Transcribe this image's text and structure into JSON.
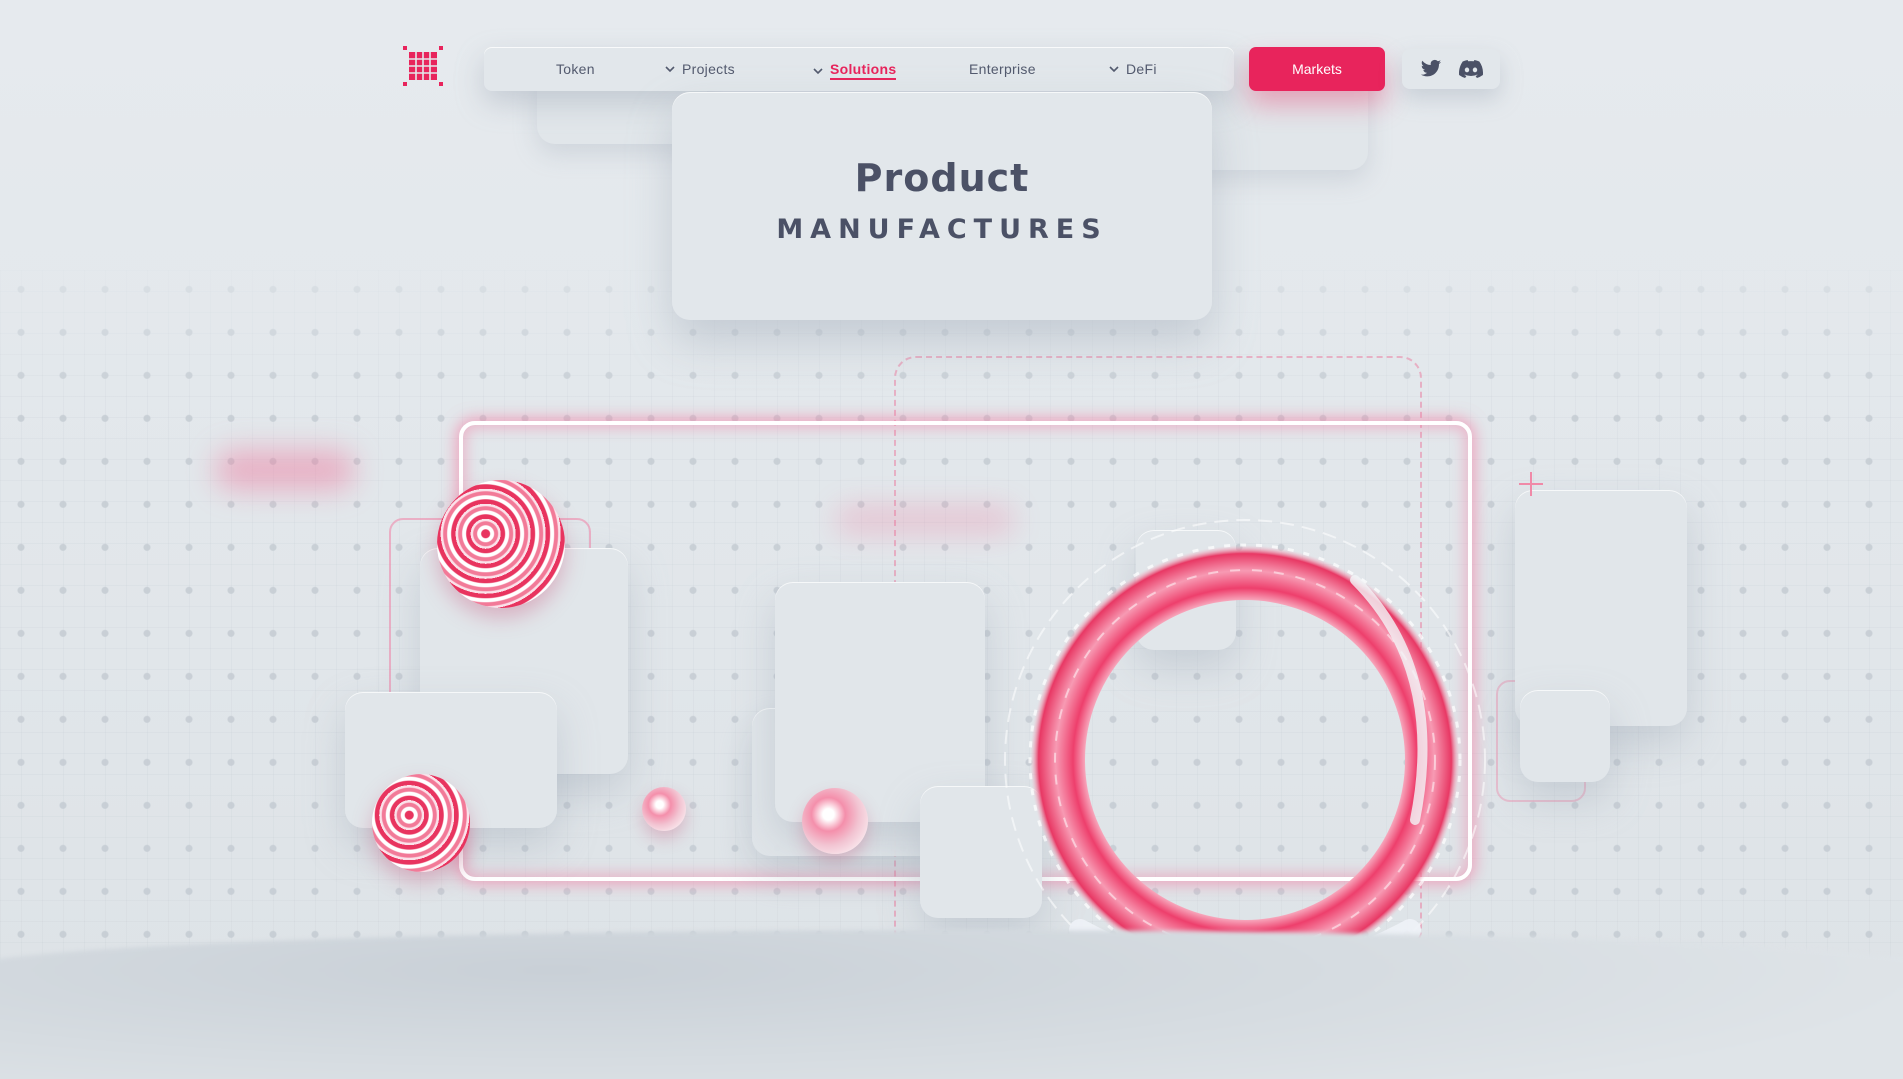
{
  "brand": {
    "logo_icon": "grid-logo-icon",
    "accent_color": "#e8245c"
  },
  "nav": {
    "items": [
      {
        "label": "Token",
        "has_dropdown": false,
        "active": false
      },
      {
        "label": "Projects",
        "has_dropdown": true,
        "active": false
      },
      {
        "label": "Solutions",
        "has_dropdown": true,
        "active": true
      },
      {
        "label": "Enterprise",
        "has_dropdown": false,
        "active": false
      },
      {
        "label": "DeFi",
        "has_dropdown": true,
        "active": false
      }
    ],
    "cta_label": "Markets"
  },
  "social": {
    "icons": [
      "twitter-icon",
      "discord-icon"
    ]
  },
  "hero": {
    "title": "Product",
    "subtitle": "MANUFACTURES"
  },
  "colors": {
    "background": "#e3e8ec",
    "text": "#4b5166",
    "accent": "#e8245c",
    "neon": "#f578a0"
  }
}
